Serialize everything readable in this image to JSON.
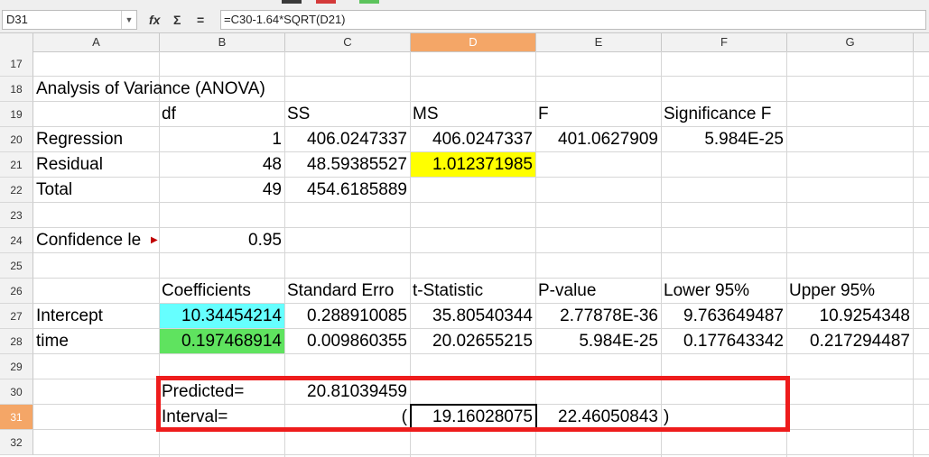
{
  "formula_bar": {
    "cell_ref": "D31",
    "function_icon": "fx",
    "sum_icon": "Σ",
    "equals_icon": "=",
    "formula": "=C30-1.64*SQRT(D21)"
  },
  "columns": [
    "A",
    "B",
    "C",
    "D",
    "E",
    "F",
    "G"
  ],
  "active_column": "D",
  "rows": [
    "17",
    "18",
    "19",
    "20",
    "21",
    "22",
    "23",
    "24",
    "25",
    "26",
    "27",
    "28",
    "29",
    "30",
    "31",
    "32"
  ],
  "active_row": "31",
  "cells": {
    "A18": "Analysis of Variance (ANOVA)",
    "B19": "df",
    "C19": "SS",
    "D19": "MS",
    "E19": "F",
    "F19": "Significance F",
    "A20": "Regression",
    "B20": "1",
    "C20": "406.0247337",
    "D20": "406.0247337",
    "E20": "401.0627909",
    "F20": "5.984E-25",
    "A21": "Residual",
    "B21": "48",
    "C21": "48.59385527",
    "D21": "1.012371985",
    "A22": "Total",
    "B22": "49",
    "C22": "454.6185889",
    "A24": "Confidence le",
    "B24": "0.95",
    "B26": "Coefficients",
    "C26": "Standard Erro",
    "D26": "t-Statistic",
    "E26": "P-value",
    "F26": "Lower 95%",
    "G26": "Upper 95%",
    "A27": "Intercept",
    "B27": "10.34454214",
    "C27": "0.288910085",
    "D27": "35.80540344",
    "E27": "2.77878E-36",
    "F27": "9.763649487",
    "G27": "10.9254348",
    "A28": "time",
    "B28": "0.197468914",
    "C28": "0.009860355",
    "D28": "20.02655215",
    "E28": "5.984E-25",
    "F28": "0.177643342",
    "G28": "0.217294487",
    "B30": "Predicted=",
    "C30": "20.81039459",
    "B31": "Interval=",
    "C31": "(",
    "D31": "19.16028075",
    "E31": "22.46050843",
    "F31": ")"
  },
  "colors": {
    "highlight_yellow": "#ffff00",
    "highlight_cyan": "#66ffff",
    "highlight_green": "#5fe35f",
    "annotation_red": "#ee1c1c",
    "active_header": "#f4a667"
  }
}
